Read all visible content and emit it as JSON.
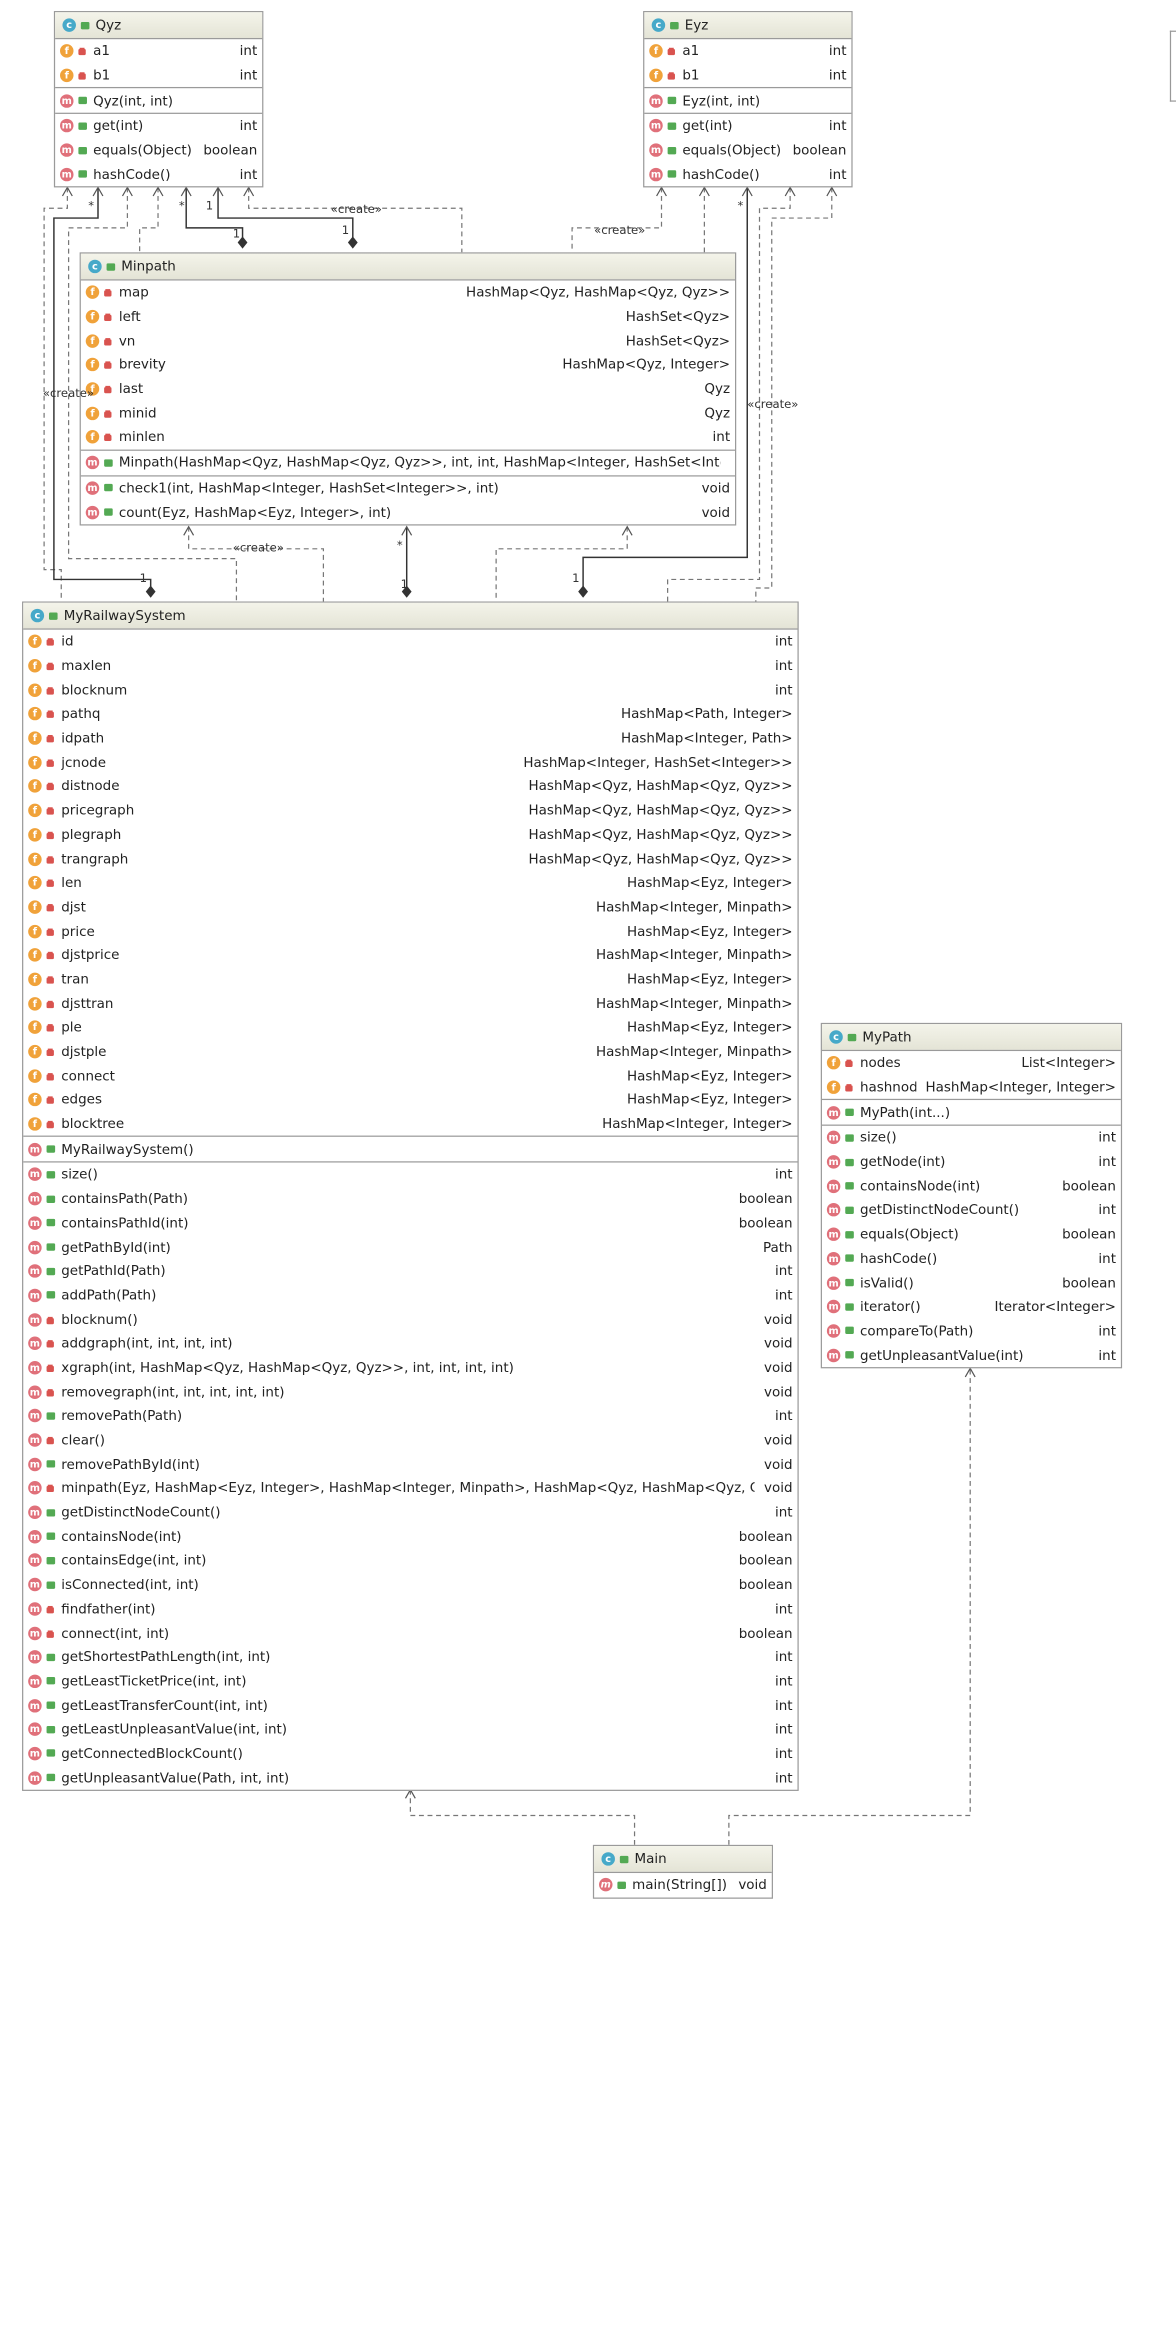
{
  "classes": {
    "qyz": {
      "name": "Qyz",
      "fields": [
        {
          "name": "a1",
          "type": "int"
        },
        {
          "name": "b1",
          "type": "int"
        }
      ],
      "constructors": [
        {
          "name": "Qyz(int, int)",
          "type": ""
        }
      ],
      "methods": [
        {
          "name": "get(int)",
          "type": "int"
        },
        {
          "name": "equals(Object)",
          "type": "boolean"
        },
        {
          "name": "hashCode()",
          "type": "int"
        }
      ]
    },
    "eyz": {
      "name": "Eyz",
      "fields": [
        {
          "name": "a1",
          "type": "int"
        },
        {
          "name": "b1",
          "type": "int"
        }
      ],
      "constructors": [
        {
          "name": "Eyz(int, int)",
          "type": ""
        }
      ],
      "methods": [
        {
          "name": "get(int)",
          "type": "int"
        },
        {
          "name": "equals(Object)",
          "type": "boolean"
        },
        {
          "name": "hashCode()",
          "type": "int"
        }
      ]
    },
    "minpath": {
      "name": "Minpath",
      "fields": [
        {
          "name": "map",
          "type": "HashMap<Qyz, HashMap<Qyz, Qyz>>"
        },
        {
          "name": "left",
          "type": "HashSet<Qyz>"
        },
        {
          "name": "vn",
          "type": "HashSet<Qyz>"
        },
        {
          "name": "brevity",
          "type": "HashMap<Qyz, Integer>"
        },
        {
          "name": "last",
          "type": "Qyz"
        },
        {
          "name": "minid",
          "type": "Qyz"
        },
        {
          "name": "minlen",
          "type": "int"
        }
      ],
      "constructors": [
        {
          "name": "Minpath(HashMap<Qyz, HashMap<Qyz, Qyz>>, int, int, HashMap<Integer, HashSet<Integer>>)",
          "type": ""
        }
      ],
      "methods": [
        {
          "name": "check1(int, HashMap<Integer, HashSet<Integer>>, int)",
          "type": "void"
        },
        {
          "name": "count(Eyz, HashMap<Eyz, Integer>, int)",
          "type": "void"
        }
      ]
    },
    "mrs": {
      "name": "MyRailwaySystem",
      "fields": [
        {
          "name": "id",
          "type": "int"
        },
        {
          "name": "maxlen",
          "type": "int"
        },
        {
          "name": "blocknum",
          "type": "int"
        },
        {
          "name": "pathq",
          "type": "HashMap<Path, Integer>"
        },
        {
          "name": "idpath",
          "type": "HashMap<Integer, Path>"
        },
        {
          "name": "jcnode",
          "type": "HashMap<Integer, HashSet<Integer>>"
        },
        {
          "name": "distnode",
          "type": "HashMap<Qyz, HashMap<Qyz, Qyz>>"
        },
        {
          "name": "pricegraph",
          "type": "HashMap<Qyz, HashMap<Qyz, Qyz>>"
        },
        {
          "name": "plegraph",
          "type": "HashMap<Qyz, HashMap<Qyz, Qyz>>"
        },
        {
          "name": "trangraph",
          "type": "HashMap<Qyz, HashMap<Qyz, Qyz>>"
        },
        {
          "name": "len",
          "type": "HashMap<Eyz, Integer>"
        },
        {
          "name": "djst",
          "type": "HashMap<Integer, Minpath>"
        },
        {
          "name": "price",
          "type": "HashMap<Eyz, Integer>"
        },
        {
          "name": "djstprice",
          "type": "HashMap<Integer, Minpath>"
        },
        {
          "name": "tran",
          "type": "HashMap<Eyz, Integer>"
        },
        {
          "name": "djsttran",
          "type": "HashMap<Integer, Minpath>"
        },
        {
          "name": "ple",
          "type": "HashMap<Eyz, Integer>"
        },
        {
          "name": "djstple",
          "type": "HashMap<Integer, Minpath>"
        },
        {
          "name": "connect",
          "type": "HashMap<Eyz, Integer>"
        },
        {
          "name": "edges",
          "type": "HashMap<Eyz, Integer>"
        },
        {
          "name": "blocktree",
          "type": "HashMap<Integer, Integer>"
        }
      ],
      "constructors": [
        {
          "name": "MyRailwaySystem()",
          "type": ""
        }
      ],
      "methods": [
        {
          "name": "size()",
          "type": "int",
          "pub": true
        },
        {
          "name": "containsPath(Path)",
          "type": "boolean",
          "pub": true
        },
        {
          "name": "containsPathId(int)",
          "type": "boolean",
          "pub": true
        },
        {
          "name": "getPathById(int)",
          "type": "Path",
          "pub": true
        },
        {
          "name": "getPathId(Path)",
          "type": "int",
          "pub": true
        },
        {
          "name": "addPath(Path)",
          "type": "int",
          "pub": true
        },
        {
          "name": "blocknum()",
          "type": "void",
          "pub": false
        },
        {
          "name": "addgraph(int, int, int, int)",
          "type": "void",
          "pub": false
        },
        {
          "name": "xgraph(int, HashMap<Qyz, HashMap<Qyz, Qyz>>, int, int, int, int)",
          "type": "void",
          "pub": false
        },
        {
          "name": "removegraph(int, int, int, int, int)",
          "type": "void",
          "pub": false
        },
        {
          "name": "removePath(Path)",
          "type": "int",
          "pub": true
        },
        {
          "name": "clear()",
          "type": "void",
          "pub": false
        },
        {
          "name": "removePathById(int)",
          "type": "void",
          "pub": true
        },
        {
          "name": "minpath(Eyz, HashMap<Eyz, Integer>, HashMap<Integer, Minpath>, HashMap<Qyz, HashMap<Qyz, Qyz>>, int)",
          "type": "void",
          "pub": false
        },
        {
          "name": "getDistinctNodeCount()",
          "type": "int",
          "pub": true
        },
        {
          "name": "containsNode(int)",
          "type": "boolean",
          "pub": true
        },
        {
          "name": "containsEdge(int, int)",
          "type": "boolean",
          "pub": true
        },
        {
          "name": "isConnected(int, int)",
          "type": "boolean",
          "pub": true
        },
        {
          "name": "findfather(int)",
          "type": "int",
          "pub": false
        },
        {
          "name": "connect(int, int)",
          "type": "boolean",
          "pub": false
        },
        {
          "name": "getShortestPathLength(int, int)",
          "type": "int",
          "pub": true
        },
        {
          "name": "getLeastTicketPrice(int, int)",
          "type": "int",
          "pub": true
        },
        {
          "name": "getLeastTransferCount(int, int)",
          "type": "int",
          "pub": true
        },
        {
          "name": "getLeastUnpleasantValue(int, int)",
          "type": "int",
          "pub": true
        },
        {
          "name": "getConnectedBlockCount()",
          "type": "int",
          "pub": true
        },
        {
          "name": "getUnpleasantValue(Path, int, int)",
          "type": "int",
          "pub": true
        }
      ]
    },
    "mypath": {
      "name": "MyPath",
      "fields": [
        {
          "name": "nodes",
          "type": "List<Integer>"
        },
        {
          "name": "hashnode",
          "type": "HashMap<Integer, Integer>"
        }
      ],
      "constructors": [
        {
          "name": "MyPath(int...)",
          "type": ""
        }
      ],
      "methods": [
        {
          "name": "size()",
          "type": "int"
        },
        {
          "name": "getNode(int)",
          "type": "int"
        },
        {
          "name": "containsNode(int)",
          "type": "boolean"
        },
        {
          "name": "getDistinctNodeCount()",
          "type": "int"
        },
        {
          "name": "equals(Object)",
          "type": "boolean"
        },
        {
          "name": "hashCode()",
          "type": "int"
        },
        {
          "name": "isValid()",
          "type": "boolean"
        },
        {
          "name": "iterator()",
          "type": "Iterator<Integer>"
        },
        {
          "name": "compareTo(Path)",
          "type": "int"
        },
        {
          "name": "getUnpleasantValue(int)",
          "type": "int"
        }
      ]
    },
    "main": {
      "name": "Main",
      "fields": [],
      "constructors": [],
      "methods": [
        {
          "name": "main(String[])",
          "type": "void",
          "static": true
        }
      ]
    }
  },
  "edge_labels": {
    "create": "«create»",
    "star": "*",
    "one": "1"
  },
  "colors": {
    "class_icon": "#46a9c9",
    "field_icon": "#f0a23a",
    "method_icon": "#e0707a",
    "private": "#d9534f",
    "public": "#53a953",
    "header": "#ecece0",
    "border": "#9a9a9a"
  }
}
